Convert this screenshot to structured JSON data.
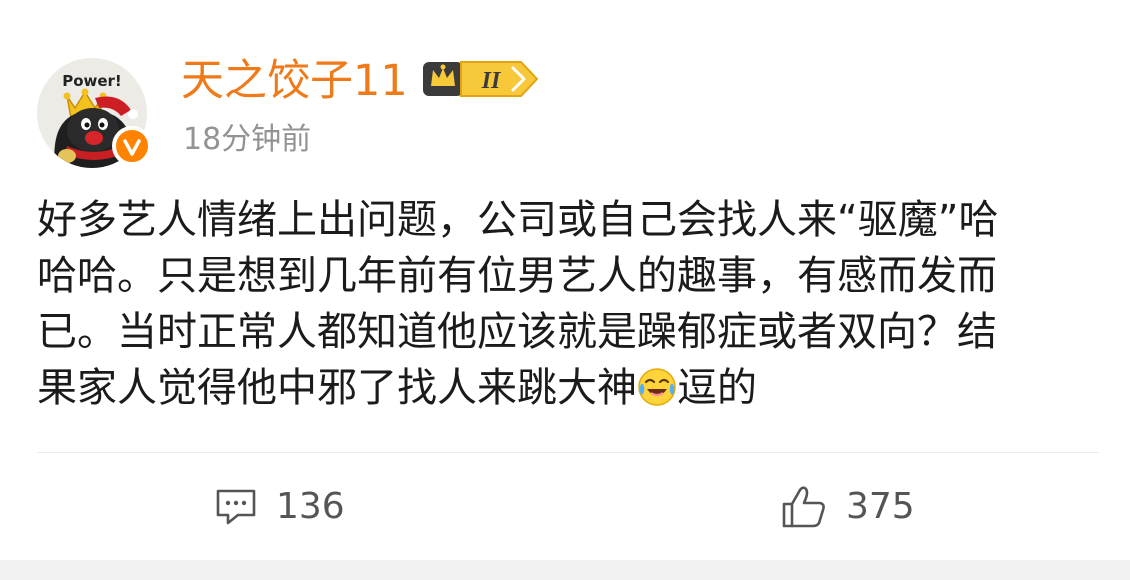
{
  "author": {
    "username": "天之饺子11",
    "level_badge": "II",
    "avatar_text": "Power!",
    "verified": true
  },
  "post": {
    "timestamp": "18分钟前",
    "text_lines": [
      "好多艺人情绪上出问题，公司或自己会找人来“驱魔”哈",
      "哈哈。只是想到几年前有位男艺人的趣事，有感而发而",
      "已。当时正常人都知道他应该就是躁郁症或者双向？结",
      "果家人觉得他中邪了找人来跳大神"
    ],
    "text_tail": "逗的",
    "emoji_icon": "laughing-crying-icon"
  },
  "actions": {
    "comment_count": "136",
    "like_count": "375",
    "comment_icon": "comment-icon",
    "like_icon": "thumbs-up-icon"
  },
  "colors": {
    "username": "#ee7a1a",
    "timestamp": "#939393",
    "body_text": "#1b1b1b",
    "verified_badge": "#ff8200",
    "action_text": "#555555"
  }
}
